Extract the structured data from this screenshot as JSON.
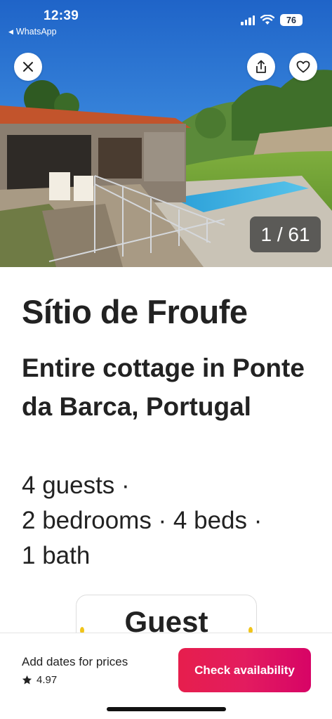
{
  "status_bar": {
    "time": "12:39",
    "back_app": "WhatsApp",
    "battery": "76"
  },
  "hero": {
    "photo_counter": "1 / 61"
  },
  "listing": {
    "title": "Sítio de Froufe",
    "subtitle": "Entire cottage in Ponte da Barca, Portugal",
    "meta_line1": "4 guests ·",
    "meta_line2": "2 bedrooms · 4 beds ·",
    "meta_line3": "1 bath",
    "guest_card_label": "Guest"
  },
  "footer": {
    "dates_text": "Add dates for prices",
    "rating": "4.97",
    "cta_label": "Check availability"
  },
  "colors": {
    "brand": "#E31C5F",
    "text": "#222222"
  },
  "icons": [
    "close-icon",
    "share-icon",
    "heart-icon",
    "star-icon",
    "signal-icon",
    "wifi-icon",
    "battery-icon",
    "laurel-icon"
  ]
}
